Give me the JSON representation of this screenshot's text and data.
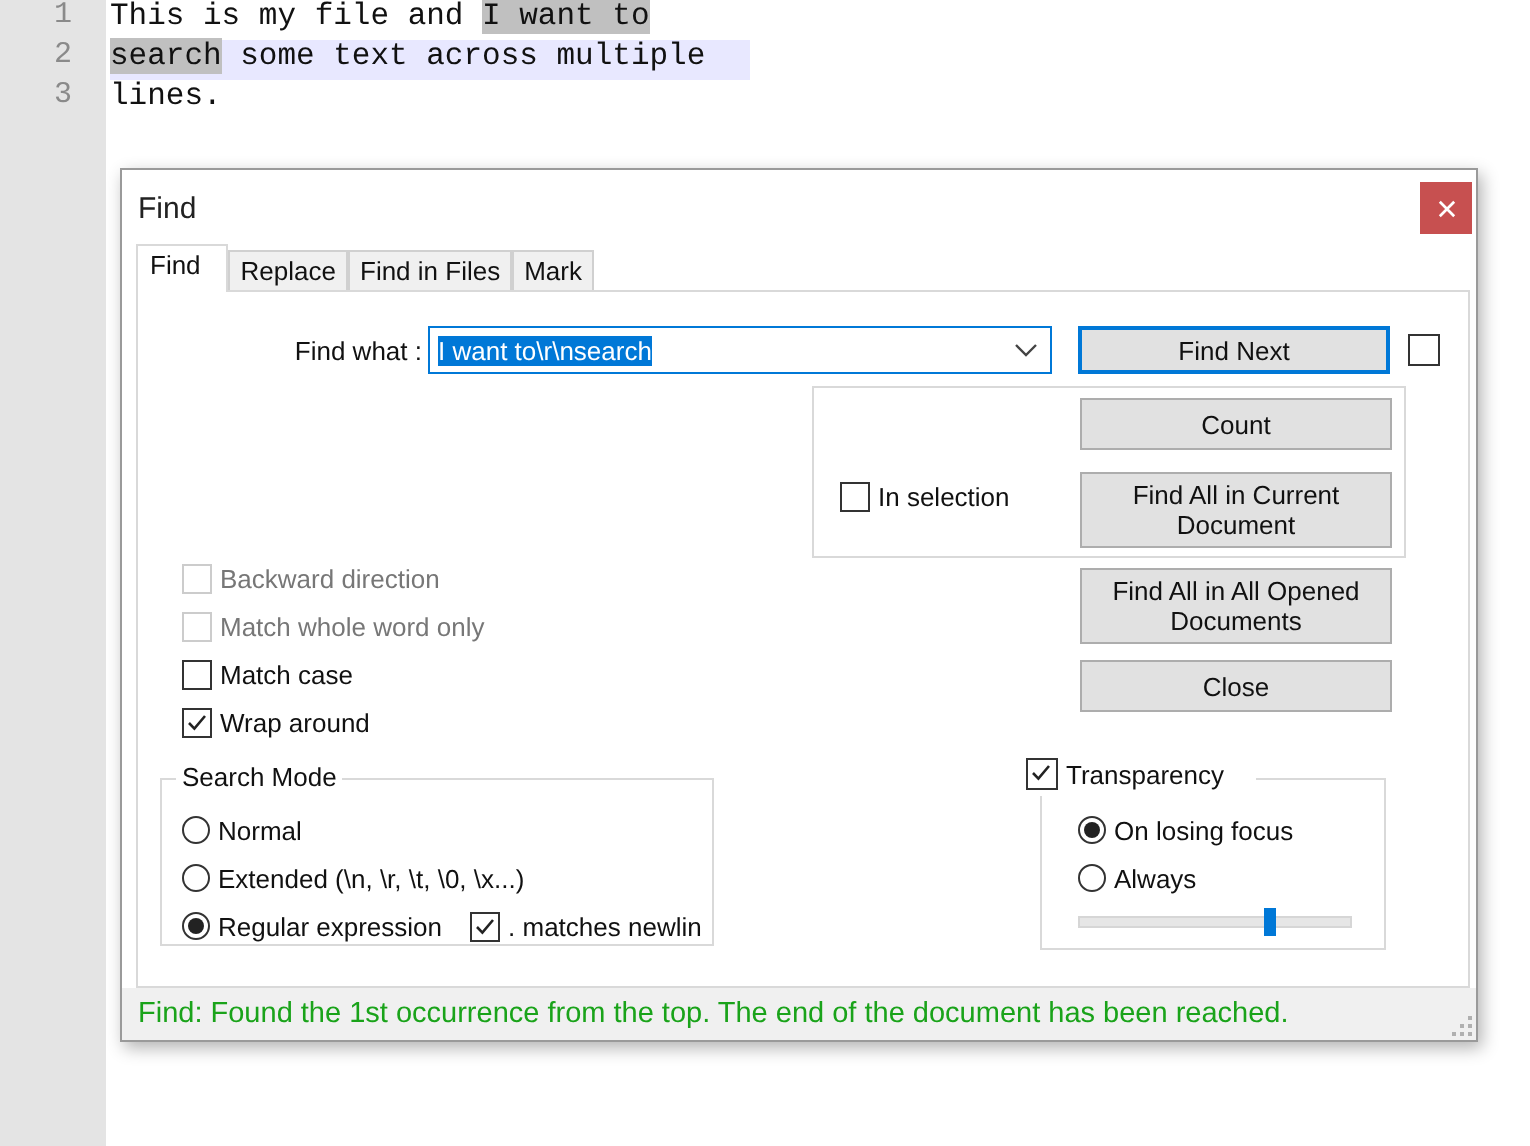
{
  "editor": {
    "lines": [
      {
        "number": "1",
        "current": false,
        "segments": [
          {
            "text": "This is my file and ",
            "selected": false
          },
          {
            "text": "I want to",
            "selected": true
          }
        ]
      },
      {
        "number": "2",
        "current": true,
        "segments": [
          {
            "text": "search",
            "selected": true
          },
          {
            "text": " some text across multiple",
            "selected": false
          }
        ]
      },
      {
        "number": "3",
        "current": false,
        "segments": [
          {
            "text": "lines.",
            "selected": false
          }
        ]
      }
    ]
  },
  "dialog": {
    "title": "Find",
    "tabs": [
      {
        "label": "Find",
        "selected": true
      },
      {
        "label": "Replace",
        "selected": false
      },
      {
        "label": "Find in Files",
        "selected": false
      },
      {
        "label": "Mark",
        "selected": false
      }
    ],
    "find_what": {
      "label": "Find what :",
      "value": "I want to\\r\\nsearch"
    },
    "find_next_button": "Find Next",
    "side_checkbox": {
      "checked": false
    },
    "in_selection": {
      "label": "In selection",
      "checked": false
    },
    "selection_buttons": [
      "Count",
      "Find All in Current Document"
    ],
    "options": [
      {
        "label": "Backward direction",
        "checked": false,
        "disabled": true
      },
      {
        "label": "Match whole word only",
        "checked": false,
        "disabled": true
      },
      {
        "label": "Match case",
        "checked": false,
        "disabled": false
      },
      {
        "label": "Wrap around",
        "checked": true,
        "disabled": false
      }
    ],
    "buttons": [
      "Find All in All Opened Documents",
      "Close"
    ],
    "search_mode": {
      "title": "Search Mode",
      "options": [
        {
          "label": "Normal",
          "selected": false
        },
        {
          "label": "Extended (\\n, \\r, \\t, \\0, \\x...)",
          "selected": false
        },
        {
          "label": "Regular expression",
          "selected": true
        }
      ],
      "dot_newline": {
        "label": ". matches newlin",
        "checked": true
      }
    },
    "transparency": {
      "label": "Transparency",
      "checked": true,
      "options": [
        {
          "label": "On losing focus",
          "selected": true
        },
        {
          "label": "Always",
          "selected": false
        }
      ],
      "level": 0.71
    },
    "status": {
      "text": "Find: Found the 1st occurrence from the top. The end of the document has been reached.",
      "color": "#1aa31a"
    }
  }
}
